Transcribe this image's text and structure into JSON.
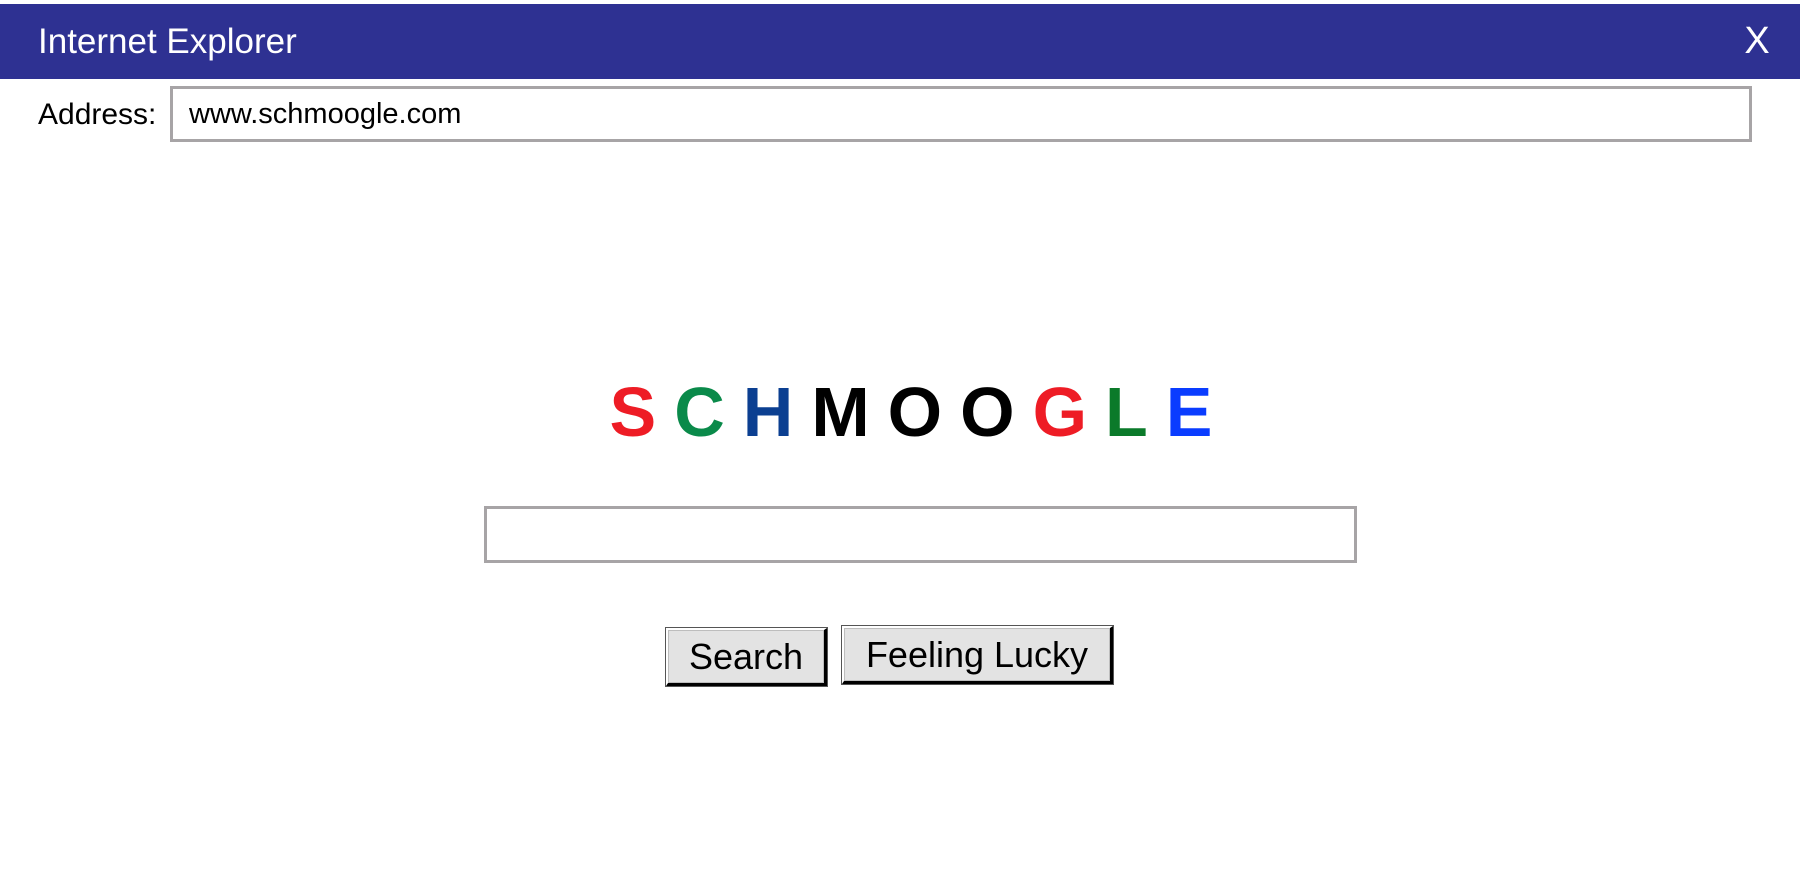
{
  "window": {
    "title": "Internet Explorer",
    "close_label": "X",
    "titlebar_color": "#2e3192"
  },
  "address_bar": {
    "label": "Address:",
    "value": "www.schmoogle.com"
  },
  "logo": {
    "letters": [
      {
        "char": "S",
        "color": "#ee1c25"
      },
      {
        "char": "C",
        "color": "#0a8a4a"
      },
      {
        "char": "H",
        "color": "#0b3f91"
      },
      {
        "char": "M",
        "color": "#000000"
      },
      {
        "char": "O",
        "color": "#000000"
      },
      {
        "char": "O",
        "color": "#000000"
      },
      {
        "char": "G",
        "color": "#ee1c25"
      },
      {
        "char": "L",
        "color": "#0b7a2a"
      },
      {
        "char": "E",
        "color": "#0a3cff"
      }
    ]
  },
  "search": {
    "value": "",
    "search_button_label": "Search",
    "lucky_button_label": "Feeling Lucky"
  }
}
